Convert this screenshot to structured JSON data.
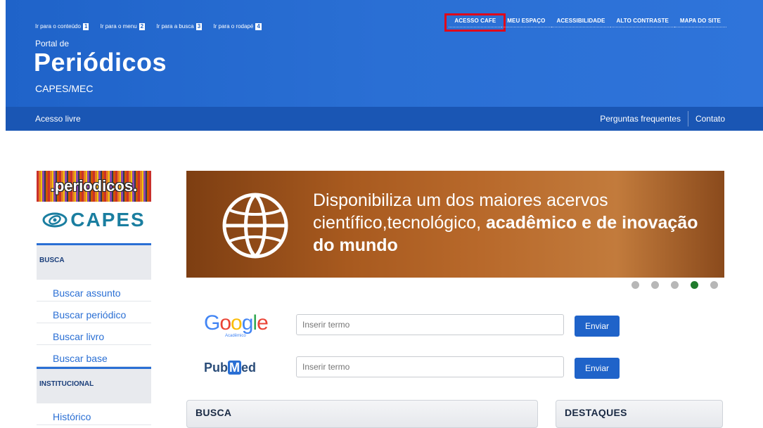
{
  "skip_links": [
    {
      "label": "Ir para o conteúdo",
      "key": "1"
    },
    {
      "label": "Ir para o menu",
      "key": "2"
    },
    {
      "label": "Ir para a busca",
      "key": "3"
    },
    {
      "label": "Ir para o rodapé",
      "key": "4"
    }
  ],
  "top_nav": [
    "ACESSO CAFE",
    "MEU ESPAÇO",
    "ACESSIBILIDADE",
    "ALTO CONTRASTE",
    "MAPA DO SITE"
  ],
  "portal": {
    "prefix": "Portal de",
    "title": "Periódicos",
    "subtitle": "CAPES/MEC"
  },
  "subnav": {
    "left": "Acesso livre",
    "faq": "Perguntas frequentes",
    "contact": "Contato"
  },
  "sidebar": {
    "logo_periodicos": ".periodicos.",
    "logo_capes": "CAPES",
    "section_busca": "BUSCA",
    "busca_items": [
      "Buscar assunto",
      "Buscar periódico",
      "Buscar livro",
      "Buscar base"
    ],
    "section_institucional": "INSTITUCIONAL",
    "institucional_items": [
      "Histórico"
    ]
  },
  "banner": {
    "text_light": "Disponibiliza um dos maiores acervos científico,tecnológico,",
    "text_bold": "acadêmico e de inovação do mundo",
    "slide_count": 5,
    "active_slide": 4
  },
  "search": {
    "google": {
      "logo": "Google",
      "logo_sub": "Acadêmico",
      "placeholder": "Inserir termo",
      "button": "Enviar"
    },
    "pubmed": {
      "logo_pre": "Pub",
      "logo_m": "M",
      "logo_post": "ed",
      "placeholder": "Inserir termo",
      "button": "Enviar"
    }
  },
  "panels": {
    "busca": "BUSCA",
    "destaques": "DESTAQUES"
  },
  "colors": {
    "header_blue": "#2a6fd4",
    "subnav_blue": "#1a56b4",
    "highlight_red": "#e0081a",
    "active_dot": "#1f7a2c"
  }
}
